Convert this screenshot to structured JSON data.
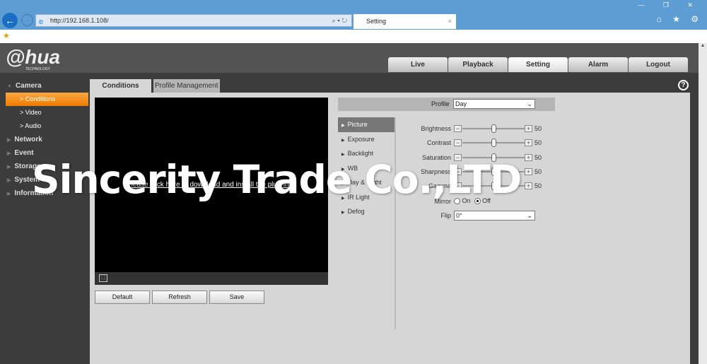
{
  "browser": {
    "url": "http://192.168.1.108/",
    "tab_title": "Setting",
    "close": "×",
    "search_tools": "⌕ ▾ ↻",
    "window_controls": "— ❐ ✕",
    "toolbar_icons": "⌂ ★ ⚙"
  },
  "header": {
    "logo": "alhua",
    "logo_sub": "TECHNOLOGY",
    "tabs": [
      {
        "label": "Live"
      },
      {
        "label": "Playback"
      },
      {
        "label": "Setting"
      },
      {
        "label": "Alarm"
      },
      {
        "label": "Logout"
      }
    ]
  },
  "sidebar": {
    "camera": "Camera",
    "sub": [
      {
        "label": "Conditions"
      },
      {
        "label": "Video"
      },
      {
        "label": "Audio"
      }
    ],
    "items": [
      {
        "label": "Network"
      },
      {
        "label": "Event"
      },
      {
        "label": "Storage"
      },
      {
        "label": "System"
      },
      {
        "label": "Information"
      }
    ]
  },
  "content_tabs": [
    {
      "label": "Conditions"
    },
    {
      "label": "Profile Management"
    }
  ],
  "video": {
    "plugin_msg": "Please click here to download and install the plug-in."
  },
  "buttons": {
    "default": "Default",
    "refresh": "Refresh",
    "save": "Save"
  },
  "profile": {
    "label": "Profile",
    "value": "Day"
  },
  "submenu": [
    {
      "label": "Picture"
    },
    {
      "label": "Exposure"
    },
    {
      "label": "Backlight"
    },
    {
      "label": "WB"
    },
    {
      "label": "Day & Night"
    },
    {
      "label": "IR Light"
    },
    {
      "label": "Defog"
    }
  ],
  "sliders": [
    {
      "label": "Brightness",
      "value": 50
    },
    {
      "label": "Contrast",
      "value": 50
    },
    {
      "label": "Saturation",
      "value": 50
    },
    {
      "label": "Sharpness",
      "value": 50
    },
    {
      "label": "Gamma",
      "value": 50
    }
  ],
  "slider_range": [
    0,
    100
  ],
  "mirror": {
    "label": "Mirror",
    "on": "On",
    "off": "Off",
    "selected": "Off"
  },
  "flip": {
    "label": "Flip",
    "value": "0°"
  },
  "help": "?",
  "watermark": "Sincerity Trade Co.,LTD",
  "colors": {
    "accent": "#f07c00",
    "header": "#535353"
  }
}
